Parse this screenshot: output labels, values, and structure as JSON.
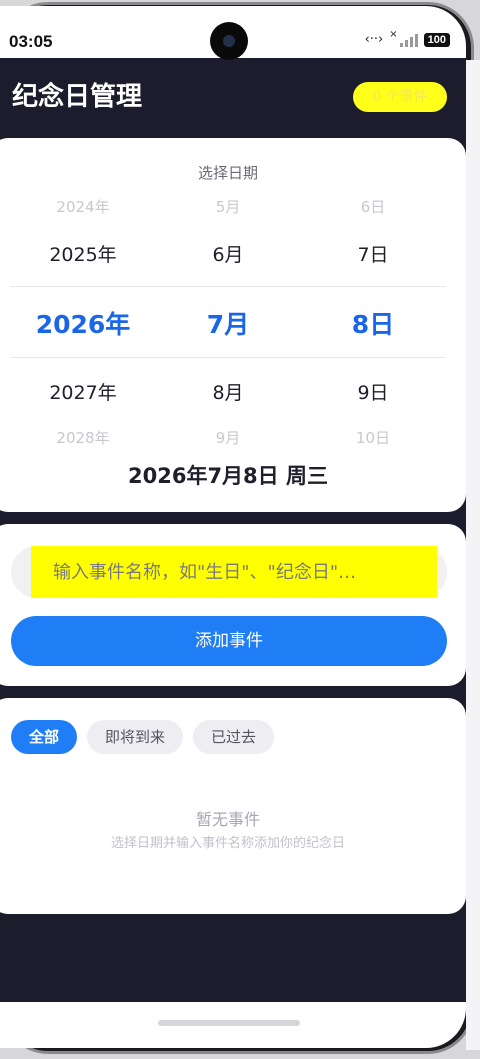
{
  "status_bar": {
    "time": "03:05",
    "network": "‹··›",
    "signal_mark": "×",
    "battery": "100"
  },
  "header": {
    "title": "纪念日管理",
    "event_count": "0 个事件"
  },
  "picker": {
    "title": "选择日期",
    "years": [
      "2024年",
      "2025年",
      "2026年",
      "2027年",
      "2028年"
    ],
    "months": [
      "5月",
      "6月",
      "7月",
      "8月",
      "9月"
    ],
    "days": [
      "6日",
      "7日",
      "8日",
      "9日",
      "10日"
    ],
    "selected_index": 2,
    "selected_date": "2026年7月8日 周三",
    "accent_color": "#1a66e8"
  },
  "add_event": {
    "input_placeholder": "输入事件名称，如\"生日\"、\"纪念日\"…",
    "input_value": "",
    "add_label": "添加事件",
    "button_color": "#1f7ef5"
  },
  "events": {
    "filters": [
      {
        "label": "全部",
        "active": true
      },
      {
        "label": "即将到来",
        "active": false
      },
      {
        "label": "已过去",
        "active": false
      }
    ],
    "empty_title": "暂无事件",
    "empty_hint": "选择日期并输入事件名称添加你的纪念日"
  }
}
